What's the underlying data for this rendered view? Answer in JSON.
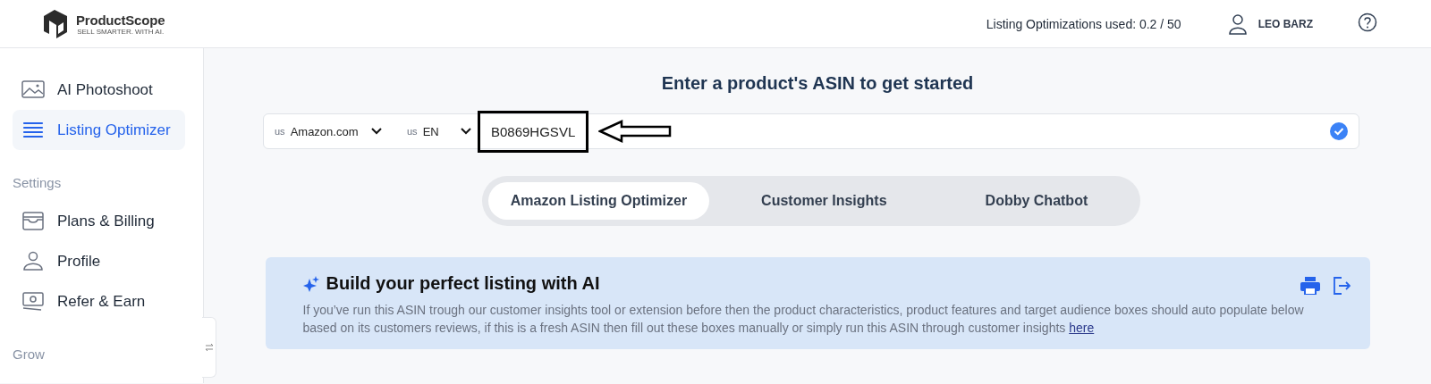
{
  "header": {
    "logo": {
      "name": "ProductScope",
      "tagline": "SELL SMARTER. WITH AI."
    },
    "usage": "Listing Optimizations used: 0.2 / 50",
    "user": "LEO BARZ"
  },
  "sidebar": {
    "items": [
      {
        "label": "AI Photoshoot",
        "selected": false
      },
      {
        "label": "Listing Optimizer",
        "selected": true
      }
    ],
    "sections": [
      {
        "heading": "Settings",
        "items": [
          {
            "label": "Plans & Billing",
            "selected": false
          },
          {
            "label": "Profile",
            "selected": false
          },
          {
            "label": "Refer & Earn",
            "selected": false
          }
        ]
      },
      {
        "heading": "Grow"
      }
    ]
  },
  "main": {
    "heading": "Enter a product's ASIN to get started",
    "search": {
      "marketplace": {
        "flag": "us",
        "value": "Amazon.com"
      },
      "language": {
        "flag": "us",
        "value": "EN"
      },
      "asin": "B0869HGSVL",
      "valid": true,
      "highlighted": true
    },
    "tabs": [
      {
        "label": "Amazon Listing Optimizer",
        "selected": true
      },
      {
        "label": "Customer Insights",
        "selected": false
      },
      {
        "label": "Dobby Chatbot",
        "selected": false
      }
    ],
    "banner": {
      "title": "Build your perfect listing with AI",
      "text": "If you’ve run this ASIN trough our customer insights tool or extension before then the product characteristics, product features and target audience boxes should auto populate below based on its customers reviews, if this is a fresh ASIN then fill out these boxes manually or simply run this ASIN through customer insights",
      "link": "here"
    }
  }
}
